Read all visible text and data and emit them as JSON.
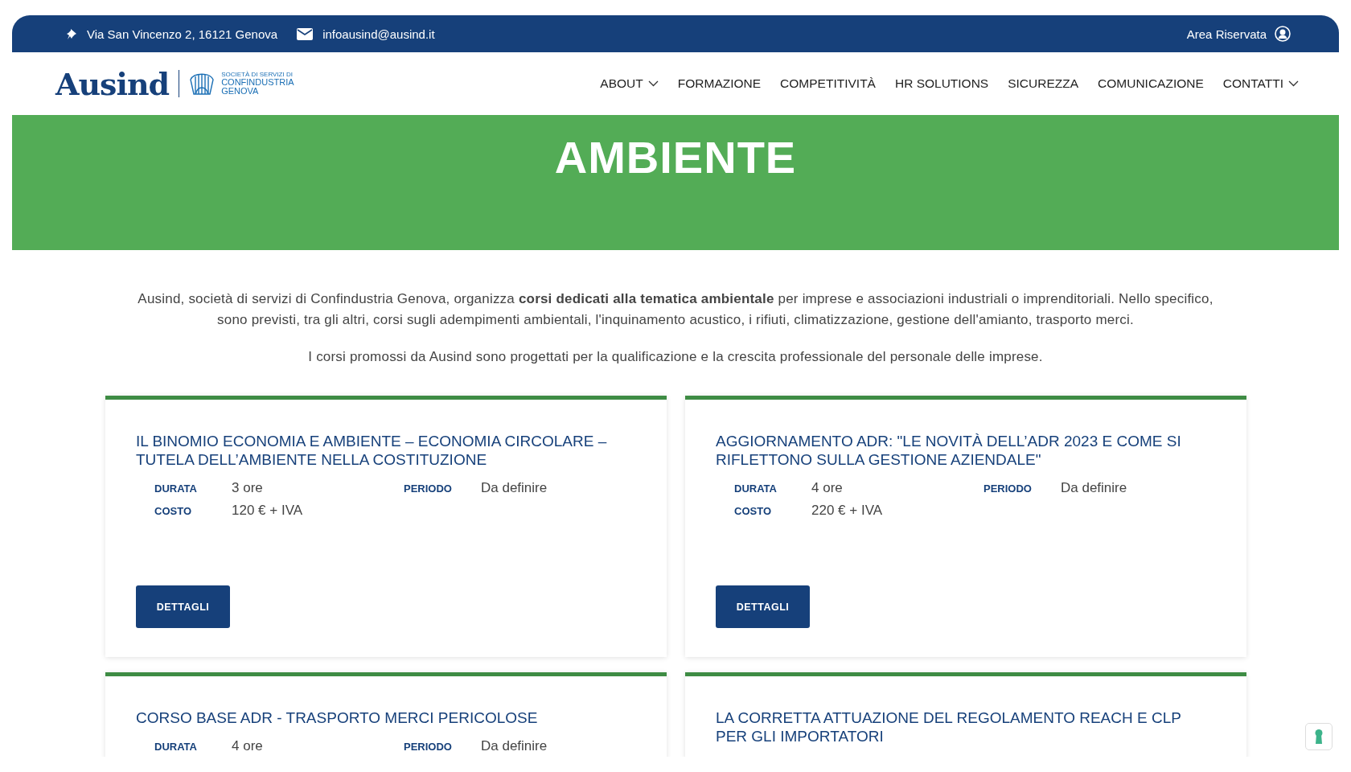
{
  "top_bar": {
    "address": "Via San Vincenzo 2, 16121 Genova",
    "email": "infoausind@ausind.it",
    "reserved_area": "Area Riservata"
  },
  "logo": {
    "name": "Ausind",
    "tagline": [
      "SOCIETÀ DI SERVIZI DI",
      "CONFINDUSTRIA",
      "GENOVA"
    ]
  },
  "nav": [
    {
      "label": "ABOUT",
      "dropdown": true
    },
    {
      "label": "FORMAZIONE",
      "dropdown": false
    },
    {
      "label": "COMPETITIVITÀ",
      "dropdown": false
    },
    {
      "label": "HR SOLUTIONS",
      "dropdown": false
    },
    {
      "label": "SICUREZZA",
      "dropdown": false
    },
    {
      "label": "COMUNICAZIONE",
      "dropdown": false
    },
    {
      "label": "CONTATTI",
      "dropdown": true
    }
  ],
  "banner": {
    "title": "AMBIENTE"
  },
  "intro": [
    "Ausind, società di servizi di Confindustria Genova, organizza **corsi dedicati alla tematica ambientale** per imprese e associazioni industriali o imprenditoriali. Nello specifico, sono previsti, tra gli altri, corsi sugli adempimenti ambientali, l'inquinamento acustico, i rifiuti, climatizzazione, gestione dell'amianto, trasporto merci.",
    "I corsi promossi da Ausind sono progettati per la qualificazione e la crescita professionale del personale delle imprese."
  ],
  "courses": [
    {
      "title": "IL BINOMIO ECONOMIA E AMBIENTE – ECONOMIA CIRCOLARE – TUTELA DELL’AMBIENTE NELLA COSTITUZIONE",
      "fields": [
        {
          "label": "DURATA",
          "value": "3 ore"
        },
        {
          "label": "PERIODO",
          "value": "Da definire"
        },
        {
          "label": "COSTO",
          "value": "120 € + IVA"
        }
      ],
      "button": "DETTAGLI"
    },
    {
      "title": "AGGIORNAMENTO ADR: \"LE NOVITÀ DELL’ADR 2023 E COME SI RIFLETTONO SULLA GESTIONE AZIENDALE\"",
      "fields": [
        {
          "label": "DURATA",
          "value": "4 ore"
        },
        {
          "label": "PERIODO",
          "value": "Da definire"
        },
        {
          "label": "COSTO",
          "value": "220 € + IVA"
        }
      ],
      "button": "DETTAGLI"
    },
    {
      "title": "CORSO BASE ADR - TRASPORTO MERCI PERICOLOSE",
      "fields": [
        {
          "label": "DURATA",
          "value": "4 ore"
        },
        {
          "label": "PERIODO",
          "value": "Da definire"
        }
      ]
    },
    {
      "title": "LA CORRETTA ATTUAZIONE DEL REGOLAMENTO REACH E CLP PER GLI IMPORTATORI"
    }
  ]
}
